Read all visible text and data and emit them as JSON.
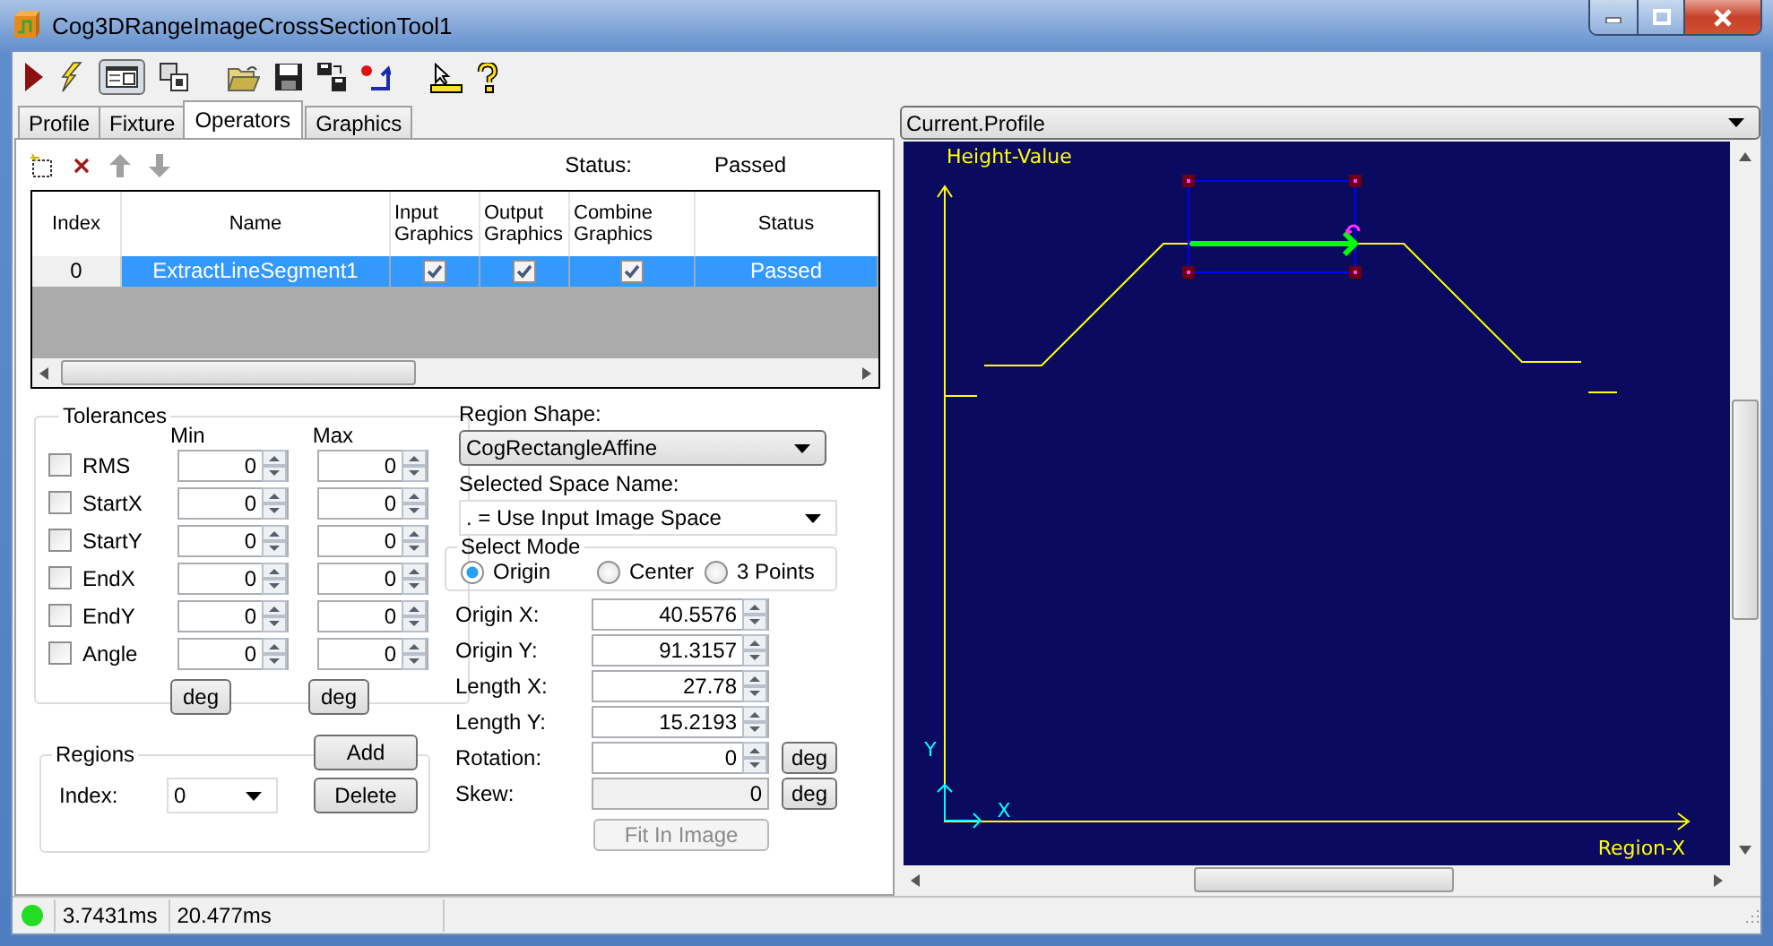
{
  "window": {
    "title": "Cog3DRangeImageCrossSectionTool1"
  },
  "tabs": [
    {
      "label": "Profile",
      "selected": false
    },
    {
      "label": "Fixture",
      "selected": false
    },
    {
      "label": "Operators",
      "selected": true
    },
    {
      "label": "Graphics",
      "selected": false
    }
  ],
  "operators": {
    "status_label": "Status:",
    "status_value": "Passed",
    "grid": {
      "columns": [
        "Index",
        "Name",
        "Input Graphics",
        "Output Graphics",
        "Combine Graphics",
        "Status"
      ],
      "rows": [
        {
          "index": "0",
          "name": "ExtractLineSegment1",
          "input_graphics": true,
          "output_graphics": true,
          "combine_graphics": true,
          "status": "Passed",
          "selected": true
        }
      ]
    }
  },
  "tolerances": {
    "title": "Tolerances",
    "min_label": "Min",
    "max_label": "Max",
    "rows": [
      {
        "label": "RMS",
        "checked": false,
        "min": "0",
        "max": "0"
      },
      {
        "label": "StartX",
        "checked": false,
        "min": "0",
        "max": "0"
      },
      {
        "label": "StartY",
        "checked": false,
        "min": "0",
        "max": "0"
      },
      {
        "label": "EndX",
        "checked": false,
        "min": "0",
        "max": "0"
      },
      {
        "label": "EndY",
        "checked": false,
        "min": "0",
        "max": "0"
      },
      {
        "label": "Angle",
        "checked": false,
        "min": "0",
        "max": "0"
      }
    ],
    "unit_buttons": [
      "deg",
      "deg"
    ]
  },
  "regions": {
    "title": "Regions",
    "add_button": "Add",
    "delete_button": "Delete",
    "index_label": "Index:",
    "index_value": "0"
  },
  "region_shape": {
    "label": "Region Shape:",
    "value": "CogRectangleAffine"
  },
  "space": {
    "label": "Selected Space Name:",
    "value": ". = Use Input Image Space"
  },
  "select_mode": {
    "title": "Select Mode",
    "options": [
      {
        "label": "Origin",
        "selected": true
      },
      {
        "label": "Center",
        "selected": false
      },
      {
        "label": "3 Points",
        "selected": false
      }
    ]
  },
  "parameters": [
    {
      "label": "Origin X:",
      "value": "40.5576",
      "kind": "spinner"
    },
    {
      "label": "Origin Y:",
      "value": "91.3157",
      "kind": "spinner"
    },
    {
      "label": "Length X:",
      "value": "27.78",
      "kind": "spinner"
    },
    {
      "label": "Length Y:",
      "value": "15.2193",
      "kind": "spinner"
    },
    {
      "label": "Rotation:",
      "value": "0",
      "kind": "spinner",
      "unit_button": "deg"
    },
    {
      "label": "Skew:",
      "value": "0",
      "kind": "readonly",
      "unit_button": "deg"
    }
  ],
  "fit_button": {
    "label": "Fit In Image",
    "disabled": true
  },
  "display": {
    "selector": "Current.Profile",
    "y_axis_label": "Height-Value",
    "x_axis_label": "Region-X",
    "origin_x_label": "X",
    "origin_y_label": "Y"
  },
  "status_bar": {
    "ok": true,
    "times": [
      "3.7431ms",
      "20.477ms"
    ]
  }
}
